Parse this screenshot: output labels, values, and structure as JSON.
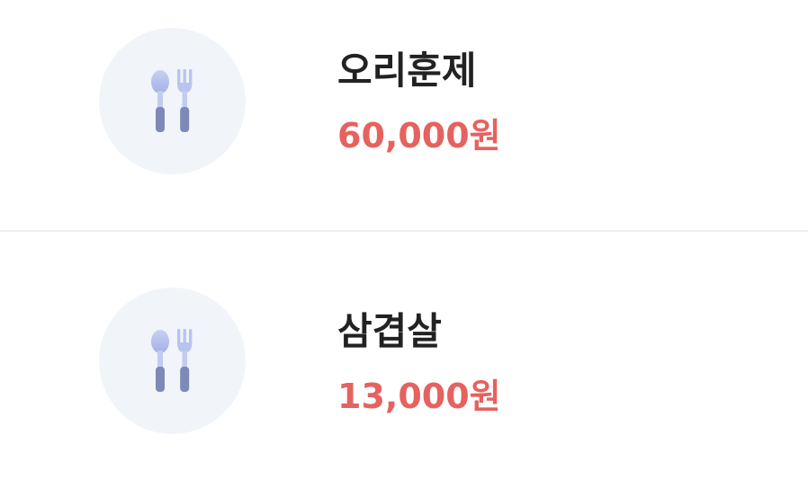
{
  "menu": {
    "items": [
      {
        "name": "오리훈제",
        "price": "60,000원",
        "icon": "utensils-icon"
      },
      {
        "name": "삼겹살",
        "price": "13,000원",
        "icon": "utensils-icon"
      }
    ]
  },
  "colors": {
    "price": "#e5625f",
    "name": "#222222",
    "thumb_bg": "#f1f4f9",
    "divider": "#eeeeef",
    "utensil_head": "#b9c4ee",
    "utensil_handle": "#7d89b7"
  }
}
